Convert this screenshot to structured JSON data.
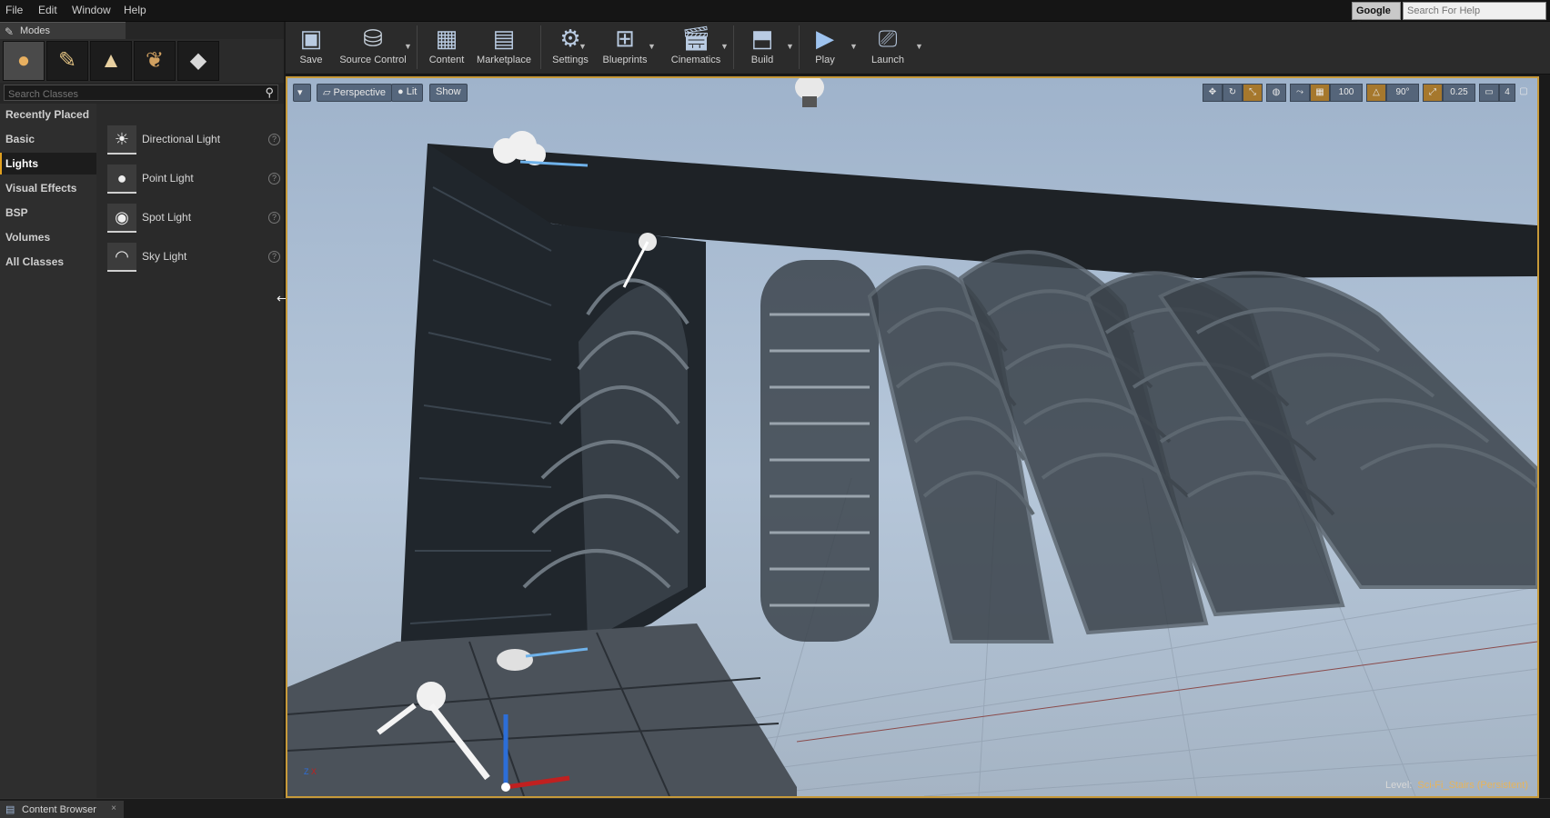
{
  "menu": [
    "File",
    "Edit",
    "Window",
    "Help"
  ],
  "help_search": {
    "provider": "Google",
    "placeholder": "Search For Help"
  },
  "modes": {
    "tab_label": "Modes",
    "search_placeholder": "Search Classes",
    "categories": [
      "Recently Placed",
      "Basic",
      "Lights",
      "Visual Effects",
      "BSP",
      "Volumes",
      "All Classes"
    ],
    "active_category": "Lights",
    "lights": [
      "Directional Light",
      "Point Light",
      "Spot Light",
      "Sky Light"
    ]
  },
  "toolbar": {
    "items": [
      {
        "label": "Save",
        "icon": "save-icon"
      },
      {
        "label": "Source Control",
        "icon": "source-control-icon"
      },
      {
        "label": "Content",
        "icon": "content-icon"
      },
      {
        "label": "Marketplace",
        "icon": "marketplace-icon"
      },
      {
        "label": "Settings",
        "icon": "settings-icon"
      },
      {
        "label": "Blueprints",
        "icon": "blueprints-icon"
      },
      {
        "label": "Cinematics",
        "icon": "cinematics-icon"
      },
      {
        "label": "Build",
        "icon": "build-icon"
      },
      {
        "label": "Play",
        "icon": "play-icon"
      },
      {
        "label": "Launch",
        "icon": "launch-icon"
      }
    ]
  },
  "viewport": {
    "view_mode": "Perspective",
    "lighting_mode": "Lit",
    "show_label": "Show",
    "grid_snap": "100",
    "rotation_snap": "90°",
    "scale_snap": "0.25",
    "camera_speed": "4",
    "level_label": "Level:",
    "level_name": "Sci-Fi_Stairs (Persistent)"
  },
  "bottom": {
    "content_browser_tab": "Content Browser"
  },
  "colors": {
    "accent": "#c79a3a",
    "panel": "#262626",
    "toolbar": "#2b2b2b"
  }
}
